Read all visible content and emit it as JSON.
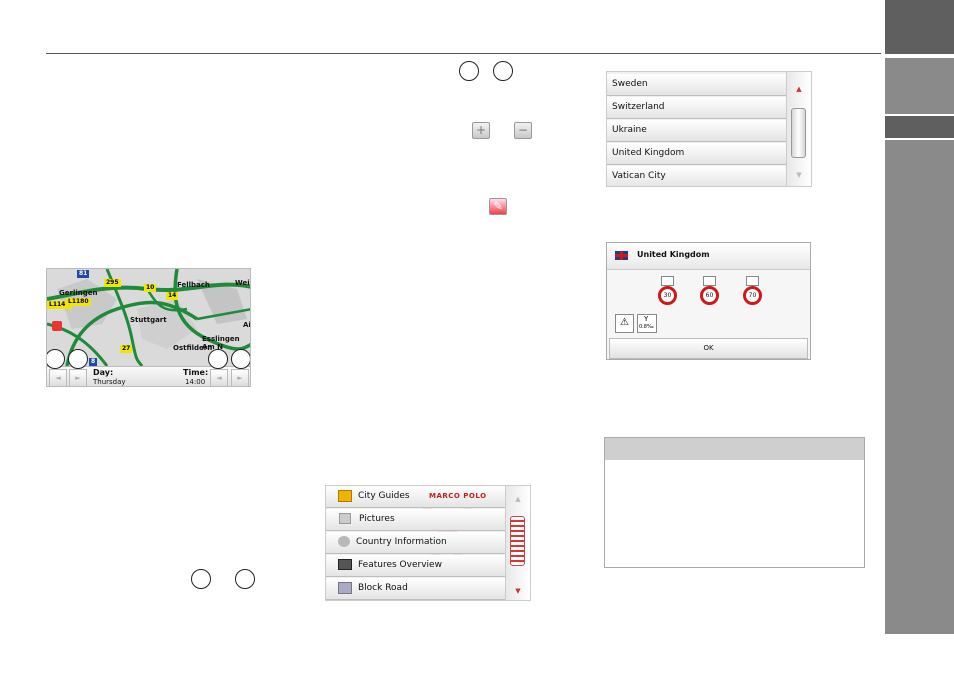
{
  "map_panel": {
    "day_label": "Day:",
    "day_value": "Thursday",
    "time_label": "Time:",
    "time_value": "14:00",
    "place_labels": [
      "Gerlingen",
      "Fellbach",
      "Stuttgart",
      "Ostfildern",
      "Esslingen Am N",
      "Wei",
      "Ai"
    ],
    "road_numbers": [
      "81",
      "295",
      "10",
      "14",
      "L1141",
      "L1180",
      "27",
      "8"
    ]
  },
  "media_menu": {
    "items": [
      {
        "label": "City Guides",
        "icon": "city-guides-icon"
      },
      {
        "label": "Pictures",
        "icon": "pictures-icon"
      },
      {
        "label": "Country Information",
        "icon": "country-information-icon"
      },
      {
        "label": "Features Overview",
        "icon": "features-overview-icon"
      },
      {
        "label": "Block Road",
        "icon": "block-road-icon"
      }
    ],
    "brand": "MARCO POLO"
  },
  "country_list": {
    "items": [
      "Sweden",
      "Switzerland",
      "Ukraine",
      "United Kingdom",
      "Vatican City"
    ]
  },
  "country_dialog": {
    "title": "United Kingdom",
    "speed_limits": [
      "30",
      "60",
      "70"
    ],
    "alcohol_limit": "0.8‰",
    "ok_label": "OK"
  },
  "colors": {
    "sidebar_tab": "#8a8a8a",
    "sidebar_tab_active": "#5f5f5f",
    "speed_ring": "#d01818",
    "road_green": "#1e8a3a"
  }
}
